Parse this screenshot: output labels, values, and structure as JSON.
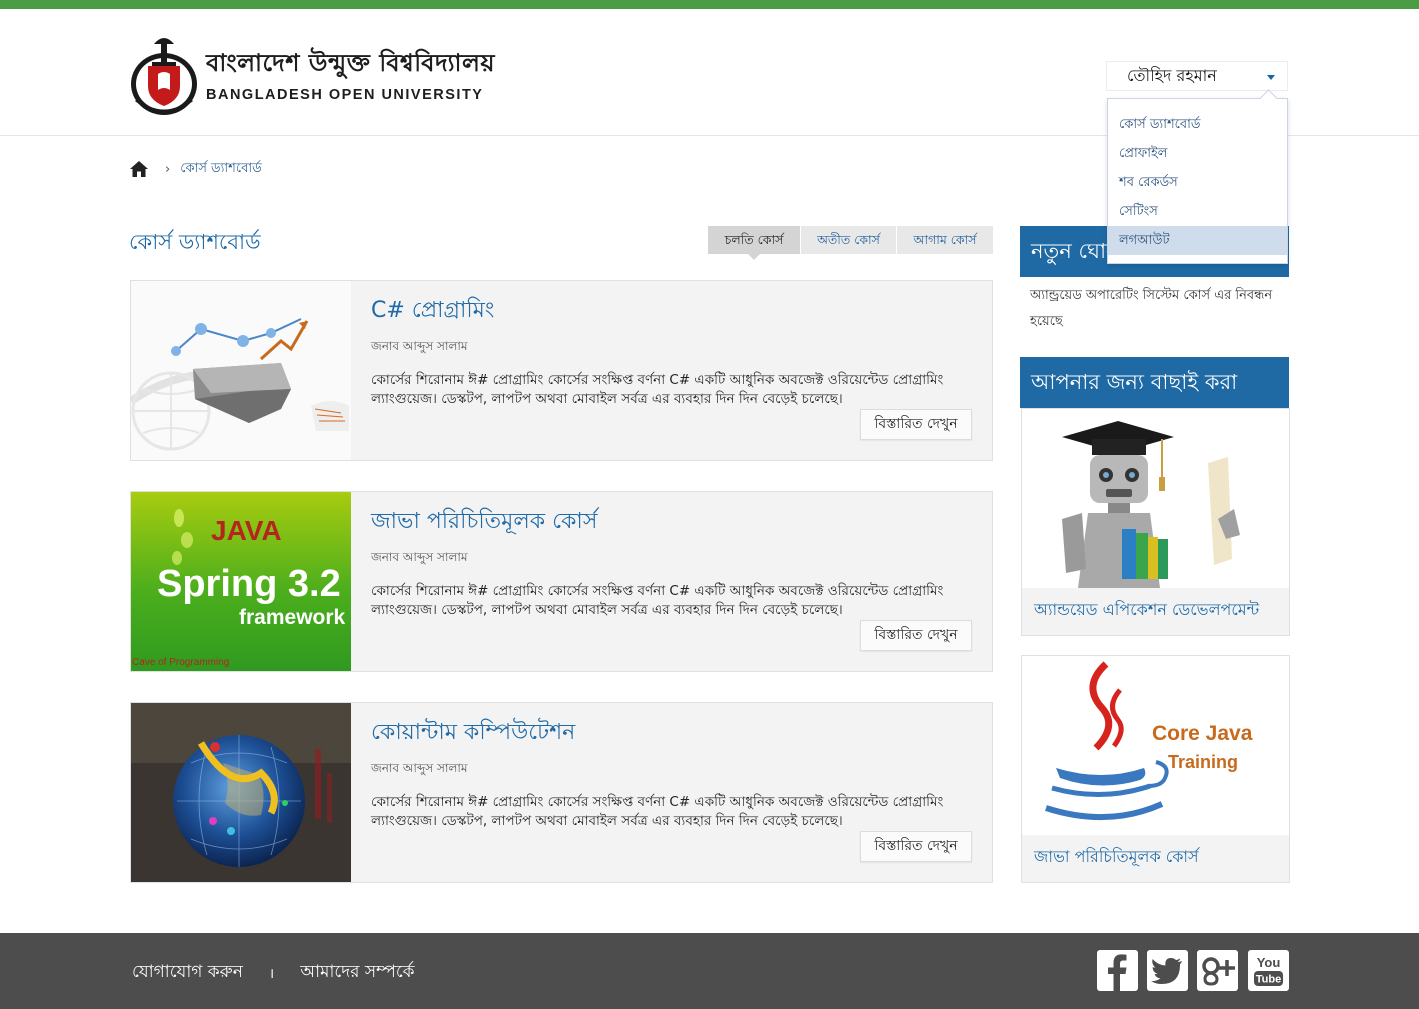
{
  "header": {
    "logo_bn": "বাংলাদেশ উন্মুক্ত বিশ্ববিদ্যালয়",
    "logo_en": "BANGLADESH OPEN UNIVERSITY",
    "user_name": "তৌহিদ রহমান",
    "user_menu": [
      {
        "label": "কোর্স ড্যাশবোর্ড"
      },
      {
        "label": "প্রোফাইল"
      },
      {
        "label": "শব রেকর্ডস"
      },
      {
        "label": "সেটিংস"
      },
      {
        "label": "লগআউট"
      }
    ]
  },
  "breadcrumb": {
    "current": "কোর্স ড্যাশবোর্ড"
  },
  "main": {
    "title": "কোর্স ড্যাশবোর্ড",
    "tabs": [
      {
        "label": "চলতি কোর্স",
        "active": true
      },
      {
        "label": "অতীত কোর্স",
        "active": false
      },
      {
        "label": "আগাম কোর্স",
        "active": false
      }
    ],
    "courses": [
      {
        "title": "C# প্রোগ্রামিং",
        "teacher": "জনাব আব্দুস সালাম",
        "description": "কোর্সের শিরোনাম ঈ# প্রোগ্রামিং কোর্সের সংক্ষিপ্ত বর্ণনা C# একটি আধুনিক অবজেক্ট ওরিয়েন্টেড প্রোগ্রামিং ল্যাংগুয়েজ। ডেস্কটপ, লাপটপ অথবা মোবাইল সর্বত্র এর ব্যবহার দিন দিন বেড়েই চলেছে।",
        "button": "বিস্তারিত দেখুন"
      },
      {
        "title": "জাভা পরিচিতিমূলক কোর্স",
        "teacher": "জনাব আব্দুস সালাম",
        "description": "কোর্সের শিরোনাম ঈ# প্রোগ্রামিং কোর্সের সংক্ষিপ্ত বর্ণনা C# একটি আধুনিক অবজেক্ট ওরিয়েন্টেড প্রোগ্রামিং ল্যাংগুয়েজ। ডেস্কটপ, লাপটপ অথবা মোবাইল সর্বত্র এর ব্যবহার দিন দিন বেড়েই চলেছে।",
        "button": "বিস্তারিত দেখুন",
        "image_text": {
          "java": "JAVA",
          "spring": "Spring 3.2",
          "framework": "framework",
          "credit": "Cave of Programming"
        }
      },
      {
        "title": "কোয়ান্টাম কম্পিউটেশন",
        "teacher": "জনাব আব্দুস সালাম",
        "description": "কোর্সের শিরোনাম ঈ# প্রোগ্রামিং কোর্সের সংক্ষিপ্ত বর্ণনা C# একটি আধুনিক অবজেক্ট ওরিয়েন্টেড প্রোগ্রামিং ল্যাংগুয়েজ। ডেস্কটপ, লাপটপ অথবা মোবাইল সর্বত্র এর ব্যবহার দিন দিন বেড়েই চলেছে।",
        "button": "বিস্তারিত দেখুন"
      }
    ]
  },
  "sidebar": {
    "news_title": "নতুন ঘোষণা",
    "news_text": "অ্যান্ড্রয়েড অপারেটিং সিস্টেম কোর্স এর নিবন্ধন হয়েছে",
    "recommended_title": "আপনার জন্য বাছাই করা",
    "recommended": [
      {
        "title": "অ্যান্ডয়েড এপিকেশন ডেভেলপমেন্ট"
      },
      {
        "title": "জাভা পরিচিতিমূলক কোর্স",
        "image_text": {
          "line1": "Core Java",
          "line2": "Training"
        }
      }
    ]
  },
  "footer": {
    "contact": "যোগাযোগ করুন",
    "separator": "।",
    "about": "আমাদের সম্পর্কে",
    "social": [
      {
        "name": "facebook-icon"
      },
      {
        "name": "twitter-icon"
      },
      {
        "name": "google-plus-icon"
      },
      {
        "name": "youtube-icon",
        "label_top": "You",
        "label_bottom": "Tube"
      }
    ]
  },
  "colors": {
    "accent": "#1f6aa5",
    "top_bar": "#4a9c45",
    "footer_bg": "#4d4d4d",
    "card_bg": "#f3f3f3"
  }
}
